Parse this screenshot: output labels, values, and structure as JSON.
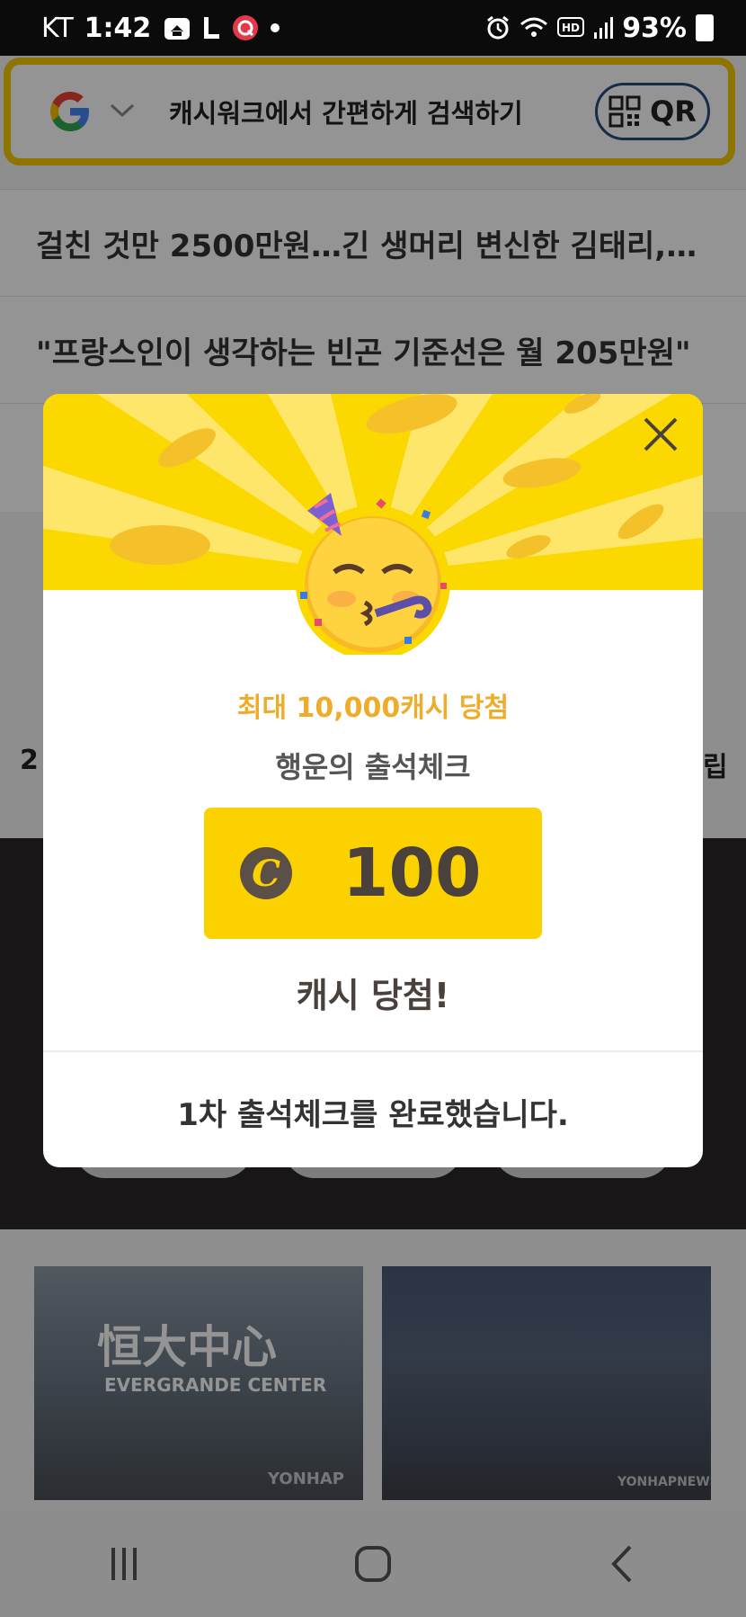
{
  "status_bar": {
    "carrier": "KT",
    "time": "1:42",
    "battery": "93%",
    "hd_label": "HD"
  },
  "search": {
    "placeholder_text": "캐시워크에서 간편하게 검색하기",
    "qr_label": "QR"
  },
  "news": [
    "걸친 것만 2500만원…긴 생머리 변신한 김태리,…",
    "\"프랑스인이 생각하는 빈곤 기준선은 월 205만원\""
  ],
  "background_fragments": {
    "left_partial": "2",
    "right_partial": "립"
  },
  "photos": [
    {
      "caption": "恒大中心",
      "sub": "EVERGRANDE CENTER",
      "watermark": "YONHAP"
    },
    {
      "watermark": "YONHAPNEWS"
    }
  ],
  "modal": {
    "headline": "최대 10,000캐시 당첨",
    "subheading": "행운의 출석체크",
    "coin_symbol": "C",
    "amount": "100",
    "won_text": "캐시 당첨!",
    "complete_text": "1차 출석체크를 완료했습니다."
  },
  "colors": {
    "accent_yellow": "#fbd800",
    "headline_orange": "#efac2b",
    "text_brown": "#4b413c"
  }
}
